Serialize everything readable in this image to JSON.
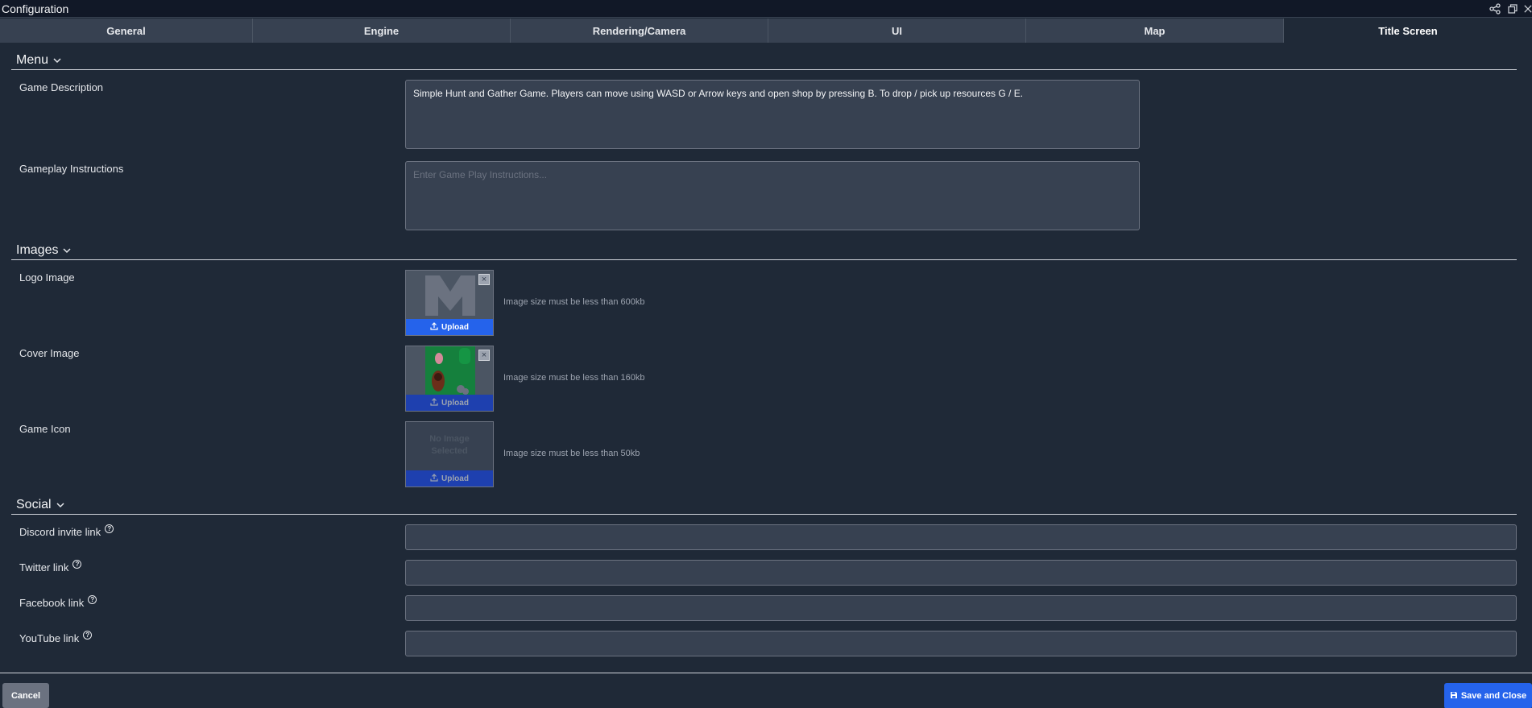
{
  "window": {
    "title": "Configuration"
  },
  "tabs": [
    {
      "label": "General"
    },
    {
      "label": "Engine"
    },
    {
      "label": "Rendering/Camera"
    },
    {
      "label": "UI"
    },
    {
      "label": "Map"
    },
    {
      "label": "Title Screen",
      "active": true
    }
  ],
  "menu": {
    "heading": "Menu",
    "game_description": {
      "label": "Game Description",
      "value": "Simple Hunt and Gather Game. Players can move using WASD or Arrow keys and open shop by pressing B. To drop / pick up resources G / E."
    },
    "gameplay_instructions": {
      "label": "Gameplay Instructions",
      "placeholder": "Enter Game Play Instructions..."
    }
  },
  "images": {
    "heading": "Images",
    "logo": {
      "label": "Logo Image",
      "note": "Image size must be less than 600kb",
      "upload": "Upload"
    },
    "cover": {
      "label": "Cover Image",
      "note": "Image size must be less than 160kb",
      "upload": "Upload"
    },
    "icon": {
      "label": "Game Icon",
      "note": "Image size must be less than 50kb",
      "upload": "Upload",
      "empty_text": "No Image Selected"
    }
  },
  "social": {
    "heading": "Social",
    "discord": {
      "label": "Discord invite link",
      "value": ""
    },
    "twitter": {
      "label": "Twitter link",
      "value": ""
    },
    "facebook": {
      "label": "Facebook link",
      "value": ""
    },
    "youtube": {
      "label": "YouTube link",
      "value": ""
    }
  },
  "footer": {
    "cancel": "Cancel",
    "save": "Save and Close"
  },
  "colors": {
    "accent": "#2563eb",
    "background": "#1f2937",
    "input": "#374151"
  }
}
